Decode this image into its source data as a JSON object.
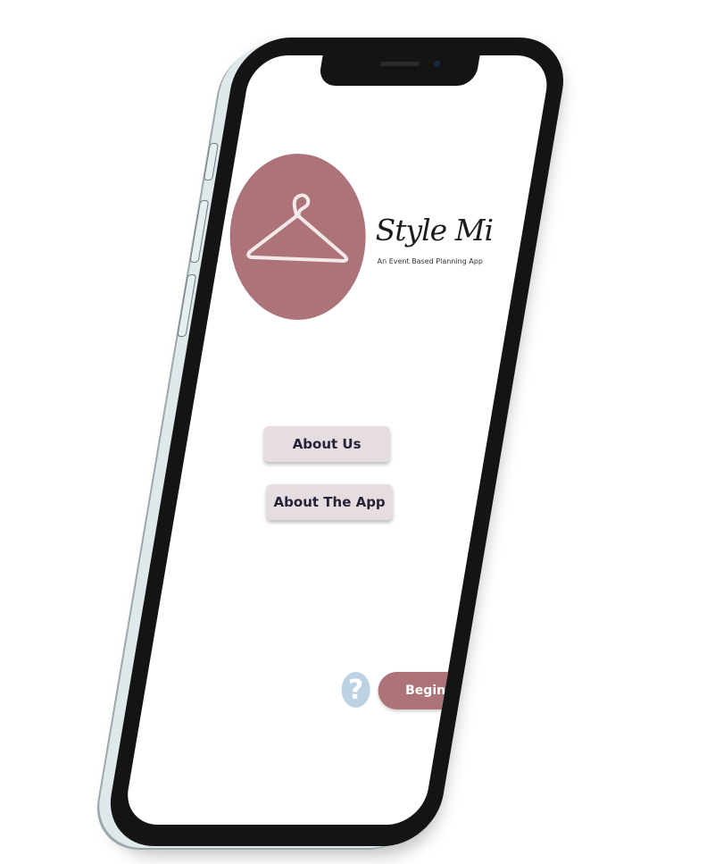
{
  "app": {
    "brand_title": "Style Mi",
    "brand_subtitle": "An Event Based Planning App"
  },
  "menu": {
    "about_us_label": "About Us",
    "about_app_label": "About The App"
  },
  "footer": {
    "help_icon": "question-icon",
    "help_glyph": "?",
    "begin_label": "Begin"
  },
  "colors": {
    "brand": "#ac7478",
    "button_bg": "#e6dde0",
    "button_text": "#262238",
    "help_icon": "#bcd2e3",
    "phone_frame": "#141414"
  }
}
